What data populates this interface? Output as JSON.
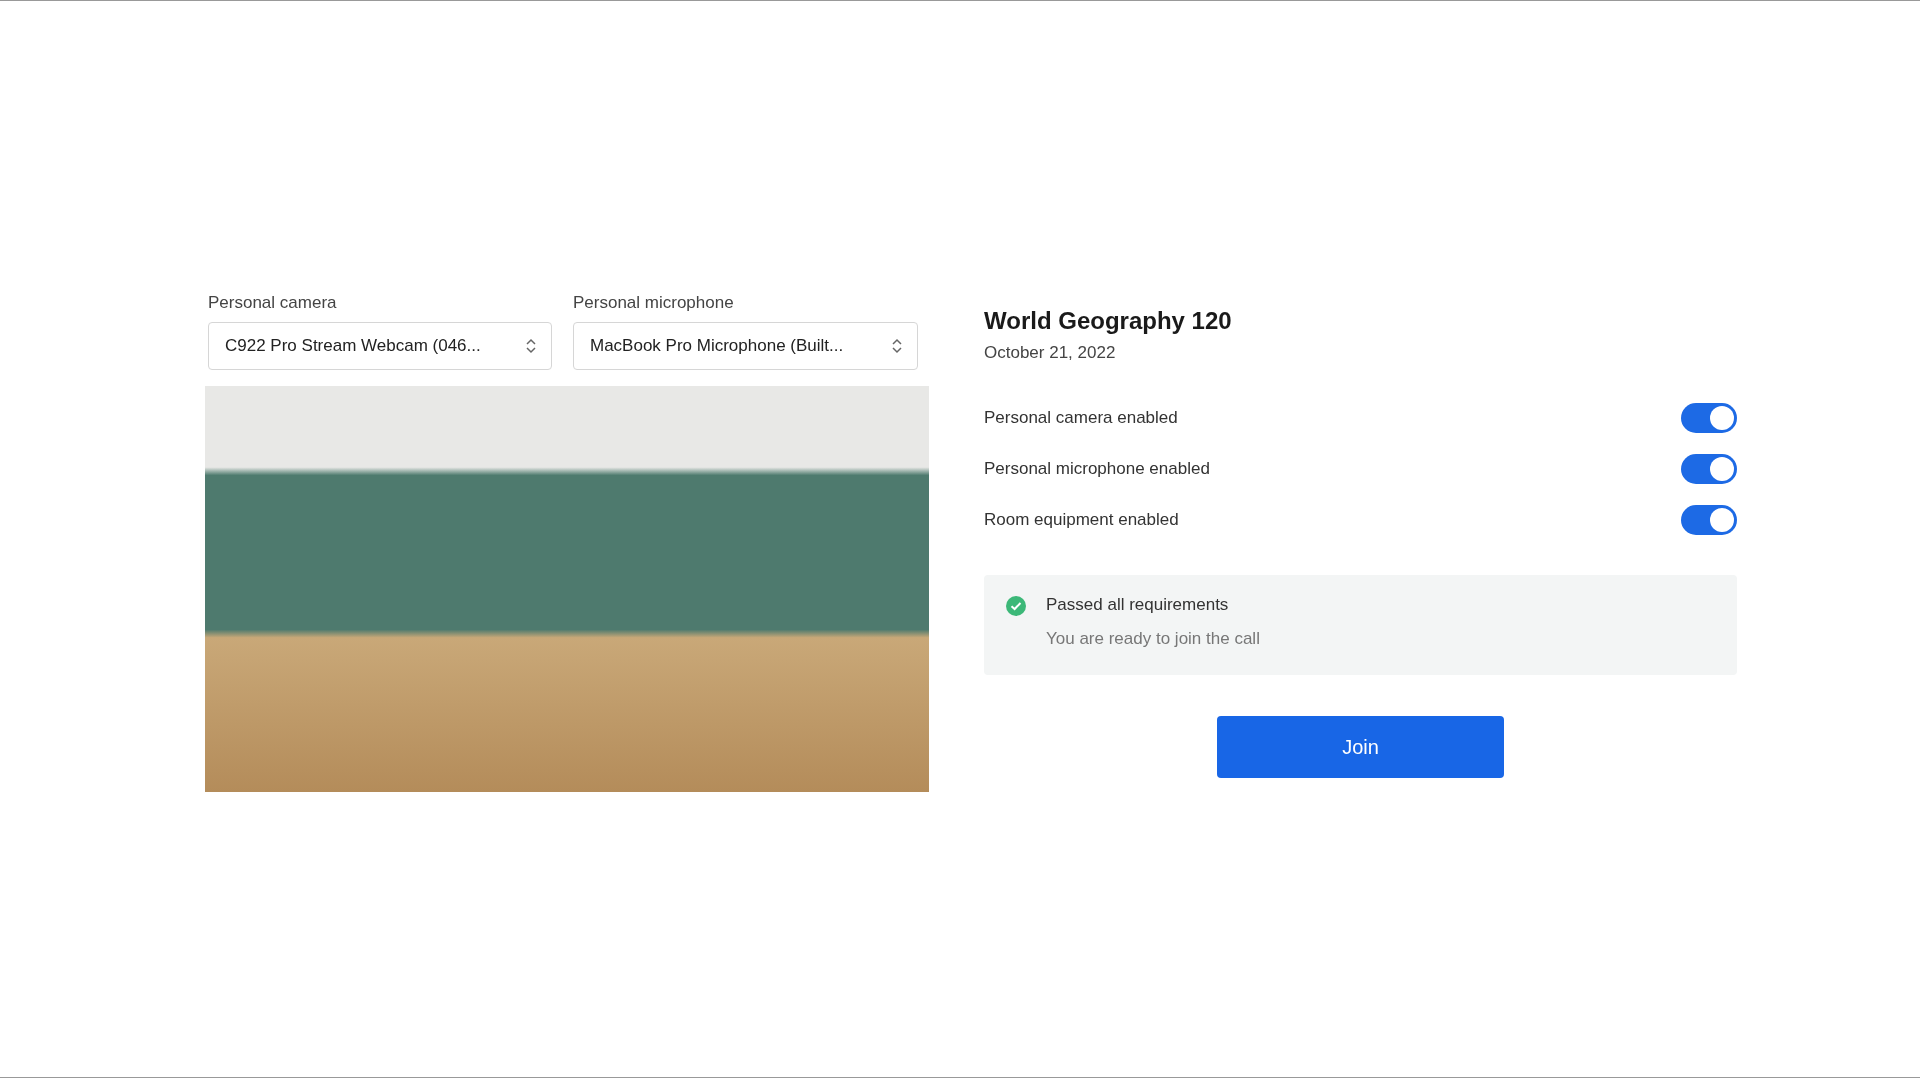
{
  "devices": [
    {
      "label": "Personal camera",
      "value": "C922 Pro Stream Webcam (046..."
    },
    {
      "label": "Personal microphone",
      "value": "MacBook Pro Microphone (Built..."
    }
  ],
  "meeting": {
    "title": "World Geography 120",
    "date": "October 21, 2022"
  },
  "toggles": [
    {
      "label": "Personal camera enabled",
      "on": true
    },
    {
      "label": "Personal microphone enabled",
      "on": true
    },
    {
      "label": "Room equipment enabled",
      "on": true
    }
  ],
  "status": {
    "passed": true,
    "title": "Passed all requirements",
    "message": "You are ready to join the call"
  },
  "join_button": "Join"
}
